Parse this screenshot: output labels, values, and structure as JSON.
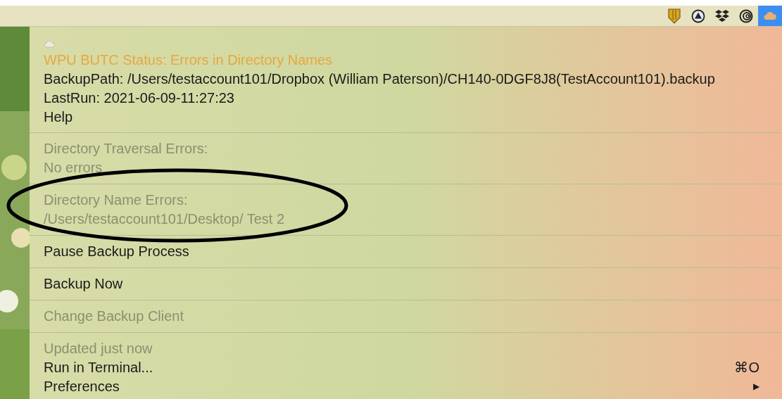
{
  "menubar": {
    "items": [
      {
        "kind": "shield",
        "selected": false
      },
      {
        "kind": "triangle",
        "selected": false
      },
      {
        "kind": "dropbox",
        "selected": false
      },
      {
        "kind": "rings",
        "selected": false
      },
      {
        "kind": "cloud",
        "selected": true
      }
    ]
  },
  "menu": {
    "title": "WPU BUTC Status: Errors in Directory Names",
    "groups": [
      [
        {
          "label": "BackupPath: /Users/testaccount101/Dropbox (William Paterson)/CH140-0DGF8J8(TestAccount101).backup",
          "disabled": false
        },
        {
          "label": "LastRun: 2021-06-09-11:27:23",
          "disabled": false
        },
        {
          "label": "Help",
          "disabled": false
        }
      ],
      [
        {
          "label": "Directory Traversal Errors:",
          "disabled": true
        },
        {
          "label": "No errors",
          "disabled": true
        }
      ],
      [
        {
          "label": "Directory Name Errors:",
          "disabled": true
        },
        {
          "label": "/Users/testaccount101/Desktop/ Test 2",
          "disabled": true
        }
      ],
      [
        {
          "label": "Pause Backup Process",
          "disabled": false
        }
      ],
      [
        {
          "label": "Backup Now",
          "disabled": false
        }
      ],
      [
        {
          "label": "Change Backup Client",
          "disabled": true
        }
      ],
      [
        {
          "label": "Updated just now",
          "disabled": true
        },
        {
          "label": "Run in Terminal...",
          "disabled": false,
          "shortcut": "⌘O"
        },
        {
          "label": "Preferences",
          "disabled": false,
          "submenu": "▶"
        }
      ]
    ]
  }
}
